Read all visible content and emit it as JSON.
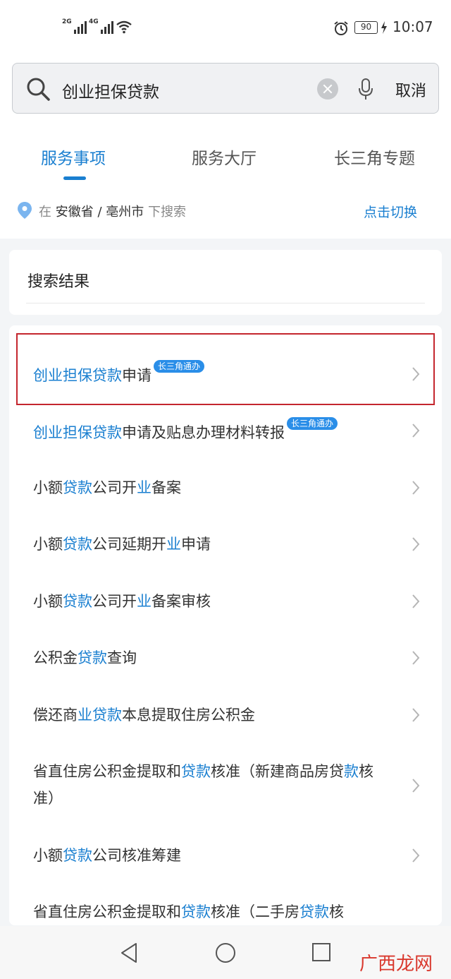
{
  "status_bar": {
    "signal_1_label": "2G",
    "signal_2_label": "4G",
    "battery": "90",
    "time": "10:07"
  },
  "search": {
    "query": "创业担保贷款",
    "cancel_label": "取消"
  },
  "tabs": [
    {
      "label": "服务事项",
      "active": true
    },
    {
      "label": "服务大厅",
      "active": false
    },
    {
      "label": "长三角专题",
      "active": false
    }
  ],
  "location": {
    "prefix": "在",
    "province": "安徽省",
    "separator": "/",
    "city": "亳州市",
    "suffix": "下搜索",
    "switch_label": "点击切换"
  },
  "results": {
    "title": "搜索结果",
    "items": [
      {
        "text": "创业担保贷款申请",
        "badge": "长三角通办"
      },
      {
        "text": "创业担保贷款申请及贴息办理材料转报",
        "badge": "长三角通办"
      },
      {
        "text": "小额贷款公司开业备案"
      },
      {
        "text": "小额贷款公司延期开业申请"
      },
      {
        "text": "小额贷款公司开业备案审核"
      },
      {
        "text": "公积金贷款查询"
      },
      {
        "text": "偿还商业贷款本息提取住房公积金"
      },
      {
        "text": "省直住房公积金提取和贷款核准（新建商品房贷款核准）"
      },
      {
        "text": "小额贷款公司核准筹建"
      },
      {
        "text": "省直住房公积金提取和贷款核准（二手房贷款核"
      }
    ]
  },
  "accent_color": "#1a7fd0",
  "highlight_border_color": "#c4262e",
  "watermark": "广西龙网"
}
